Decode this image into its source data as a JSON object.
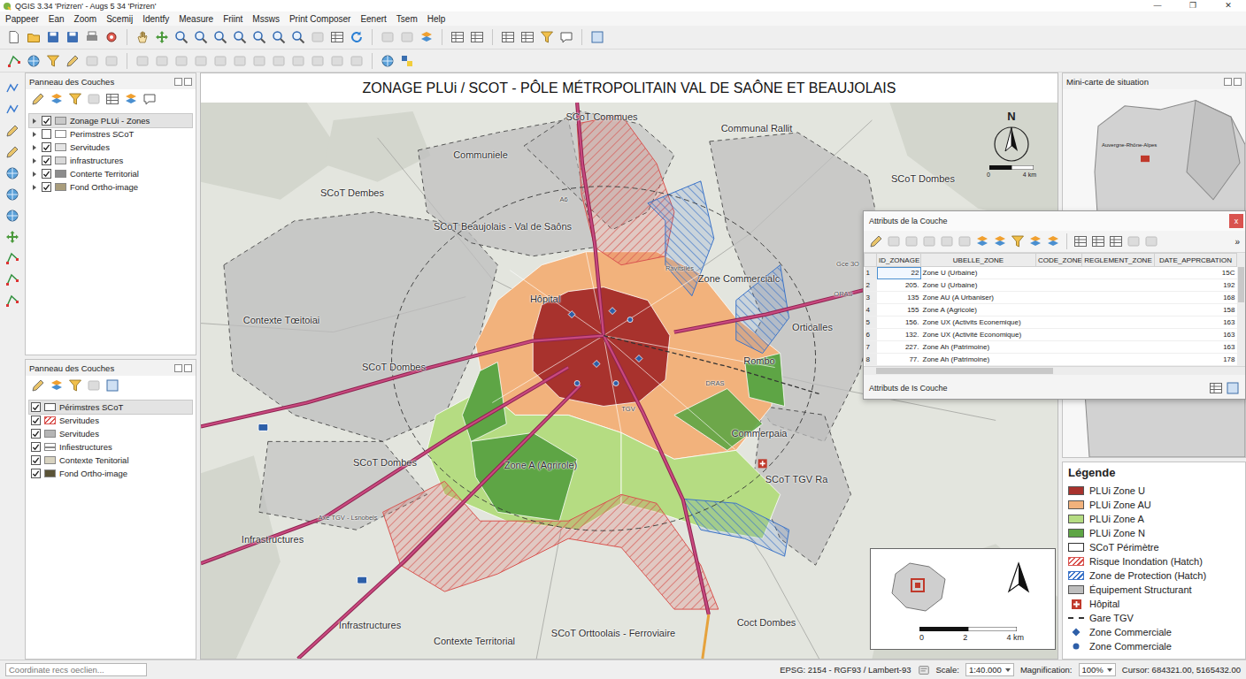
{
  "window": {
    "title": "QGIS 3.34 'Prizren' - Augs 5 34 'Prizren'",
    "controls": [
      "—",
      "❐",
      "✕"
    ]
  },
  "menu": [
    "Pappeer",
    "Ean",
    "Zoom",
    "Scemij",
    "Identfy",
    "Measure",
    "Friint",
    "Mssws",
    "Print Composer",
    "Eenert",
    "Tsem",
    "Help"
  ],
  "layers_panel_top": {
    "title": "Panneau des Couches",
    "layers": [
      {
        "label": "Zonage PLUi - Zones",
        "checked": true,
        "selected": true,
        "expanded": false,
        "color": "#c9c9c9"
      },
      {
        "label": "Perimstres SCoT",
        "checked": false,
        "selected": false,
        "expanded": false,
        "color": "#ffffff"
      },
      {
        "label": "Servitudes",
        "checked": true,
        "selected": false,
        "expanded": false,
        "color": "#e4e4e4"
      },
      {
        "label": "infrastructures",
        "checked": true,
        "selected": false,
        "expanded": false,
        "color": "#d9d9d9"
      },
      {
        "label": "Conterte Territorial",
        "checked": true,
        "selected": false,
        "expanded": false,
        "color": "#8c8c8c"
      },
      {
        "label": "Fond Ortho-image",
        "checked": true,
        "selected": false,
        "expanded": false,
        "color": "#a99d7c"
      }
    ]
  },
  "layers_panel_bottom": {
    "title": "Panneau des Couches",
    "layers": [
      {
        "label": "Périmstres SCoT",
        "checked": true,
        "selected": true,
        "kind": "outline",
        "color": "#555555"
      },
      {
        "label": "Servitudes",
        "checked": true,
        "selected": false,
        "kind": "hatch",
        "color": "#d9534f"
      },
      {
        "label": "Servitudes",
        "checked": true,
        "selected": false,
        "kind": "fill",
        "color": "#b5b5b5"
      },
      {
        "label": "Infiestructures",
        "checked": true,
        "selected": false,
        "kind": "line",
        "color": "#8a8a8a"
      },
      {
        "label": "Contexte Tenitorial",
        "checked": true,
        "selected": false,
        "kind": "fill",
        "color": "#d8d3c0"
      },
      {
        "label": "Fond Ortho-image",
        "checked": true,
        "selected": false,
        "kind": "fill",
        "color": "#5b5437"
      }
    ]
  },
  "map": {
    "title": "ZONAGE PLUi / SCOT - PÔLE MÉTROPOLITAIN VAL DE SAÔNE ET BEAUJOLAIS",
    "labels": [
      {
        "text": "SCoT Commues",
        "kind": "place"
      },
      {
        "text": "Communal Rallit",
        "kind": "place"
      },
      {
        "text": "Communiele",
        "kind": "place"
      },
      {
        "text": "SCoT Dembes",
        "kind": "place"
      },
      {
        "text": "SCoT Beaujolais - Val de Saôns",
        "kind": "place"
      },
      {
        "text": "SCoT Dombes",
        "kind": "place"
      },
      {
        "text": "Hôpital",
        "kind": "place"
      },
      {
        "text": "Zone Commercialc",
        "kind": "place"
      },
      {
        "text": "Contexte Tœitoiai",
        "kind": "place"
      },
      {
        "text": "Orticalles",
        "kind": "place"
      },
      {
        "text": "SCoT Dombes",
        "kind": "place"
      },
      {
        "text": "Rombo",
        "kind": "place"
      },
      {
        "text": "Commerpaia",
        "kind": "place"
      },
      {
        "text": "SCoT TGV Ra",
        "kind": "place"
      },
      {
        "text": "SCoT Dombes",
        "kind": "place"
      },
      {
        "text": "Zone A (Agrirole)",
        "kind": "place"
      },
      {
        "text": "Infrastructures",
        "kind": "place"
      },
      {
        "text": "Infrastructures",
        "kind": "place"
      },
      {
        "text": "Contexte Territorial",
        "kind": "place"
      },
      {
        "text": "SCoT Orttoolais - Ferroviaire",
        "kind": "place"
      },
      {
        "text": "Coct Dombes",
        "kind": "place"
      },
      {
        "text": "Ravitsiles",
        "kind": "road"
      },
      {
        "text": "DRAS",
        "kind": "road"
      },
      {
        "text": "Gce 3O",
        "kind": "road"
      },
      {
        "text": "ORAS",
        "kind": "road"
      },
      {
        "text": "Axe TGV - Lsnobels",
        "kind": "road"
      },
      {
        "text": "A6",
        "kind": "road"
      },
      {
        "text": "TGV",
        "kind": "road"
      }
    ],
    "north": "N",
    "scale": [
      "0",
      "4 km"
    ]
  },
  "minimap": {
    "title": "Mini-carte de situation",
    "region": "Auvergne-Rhône-Alpes"
  },
  "attribute_table": {
    "title": "Attributs de la Couche",
    "close": "x",
    "overflow": "»",
    "columns": [
      "ID_ZONAGE",
      "UBELLE_ZONE",
      "CODE_ZONE",
      "REGLEMENT_ZONE",
      "DATE_APPRCBATION"
    ],
    "rows": [
      {
        "num": "1",
        "id": "22",
        "label": "Zone U (Urbaine)",
        "date": "15C",
        "selected": true
      },
      {
        "num": "2",
        "id": "205.",
        "label": "Zone U (Urbaine)",
        "date": "192",
        "selected": false
      },
      {
        "num": "3",
        "id": "135",
        "label": "Zone AU (A Urbaniser)",
        "date": "168",
        "selected": false
      },
      {
        "num": "4",
        "id": "155",
        "label": "Zone A (Agricole)",
        "date": "158",
        "selected": false
      },
      {
        "num": "5",
        "id": "156.",
        "label": "Zone UX (Activits Econemique)",
        "date": "163",
        "selected": false
      },
      {
        "num": "6",
        "id": "132.",
        "label": "Zone UX (Activité Economique)",
        "date": "163",
        "selected": false
      },
      {
        "num": "7",
        "id": "227.",
        "label": "Zone Ah (Patrimoine)",
        "date": "163",
        "selected": false
      },
      {
        "num": "8",
        "id": "77.",
        "label": "Zone Ah (Patrimoine)",
        "date": "178",
        "selected": false
      }
    ],
    "footer": "Attributs de Is Couche"
  },
  "legend": {
    "title": "Légende",
    "items": [
      {
        "label": "PLUi Zone U",
        "kind": "fill",
        "color": "#a8322d"
      },
      {
        "label": "PLUi Zone AU",
        "kind": "fill",
        "color": "#f2b27c"
      },
      {
        "label": "PLUi Zone A",
        "kind": "fill",
        "color": "#b5dc82"
      },
      {
        "label": "PLUi Zone N",
        "kind": "fill",
        "color": "#5ea545"
      },
      {
        "label": "SCoT Périmètre",
        "kind": "outline",
        "color": "#333333"
      },
      {
        "label": "Risque Inondation (Hatch)",
        "kind": "hatch",
        "color": "#d9534f"
      },
      {
        "label": "Zone de Protection (Hatch)",
        "kind": "hatch",
        "color": "#3b73c8"
      },
      {
        "label": "Équipement Structurant",
        "kind": "fill",
        "color": "#bdbdbd"
      },
      {
        "label": "Hôpital",
        "kind": "icon",
        "color": "#c0392b"
      },
      {
        "label": "Gare TGV",
        "kind": "line",
        "color": "#333333"
      },
      {
        "label": "Zone Commerciale",
        "kind": "diamond",
        "color": "#2e5fa8"
      },
      {
        "label": "Zone Commerciale",
        "kind": "dot",
        "color": "#2e5fa8"
      }
    ]
  },
  "inset": {
    "scale": [
      "0",
      "2",
      "4 km"
    ]
  },
  "status_bar": {
    "coordinate_placeholder": "Coordinate recs oeclien...",
    "crs": "EPSG: 2154 - RGF93 / Lambert-93",
    "scale_label": "Scale:",
    "scale": "1:40.000",
    "magnification_label": "Magnification:",
    "magnification": "100%",
    "cursor": "Cursor: 684321.00, 5165432.00"
  }
}
